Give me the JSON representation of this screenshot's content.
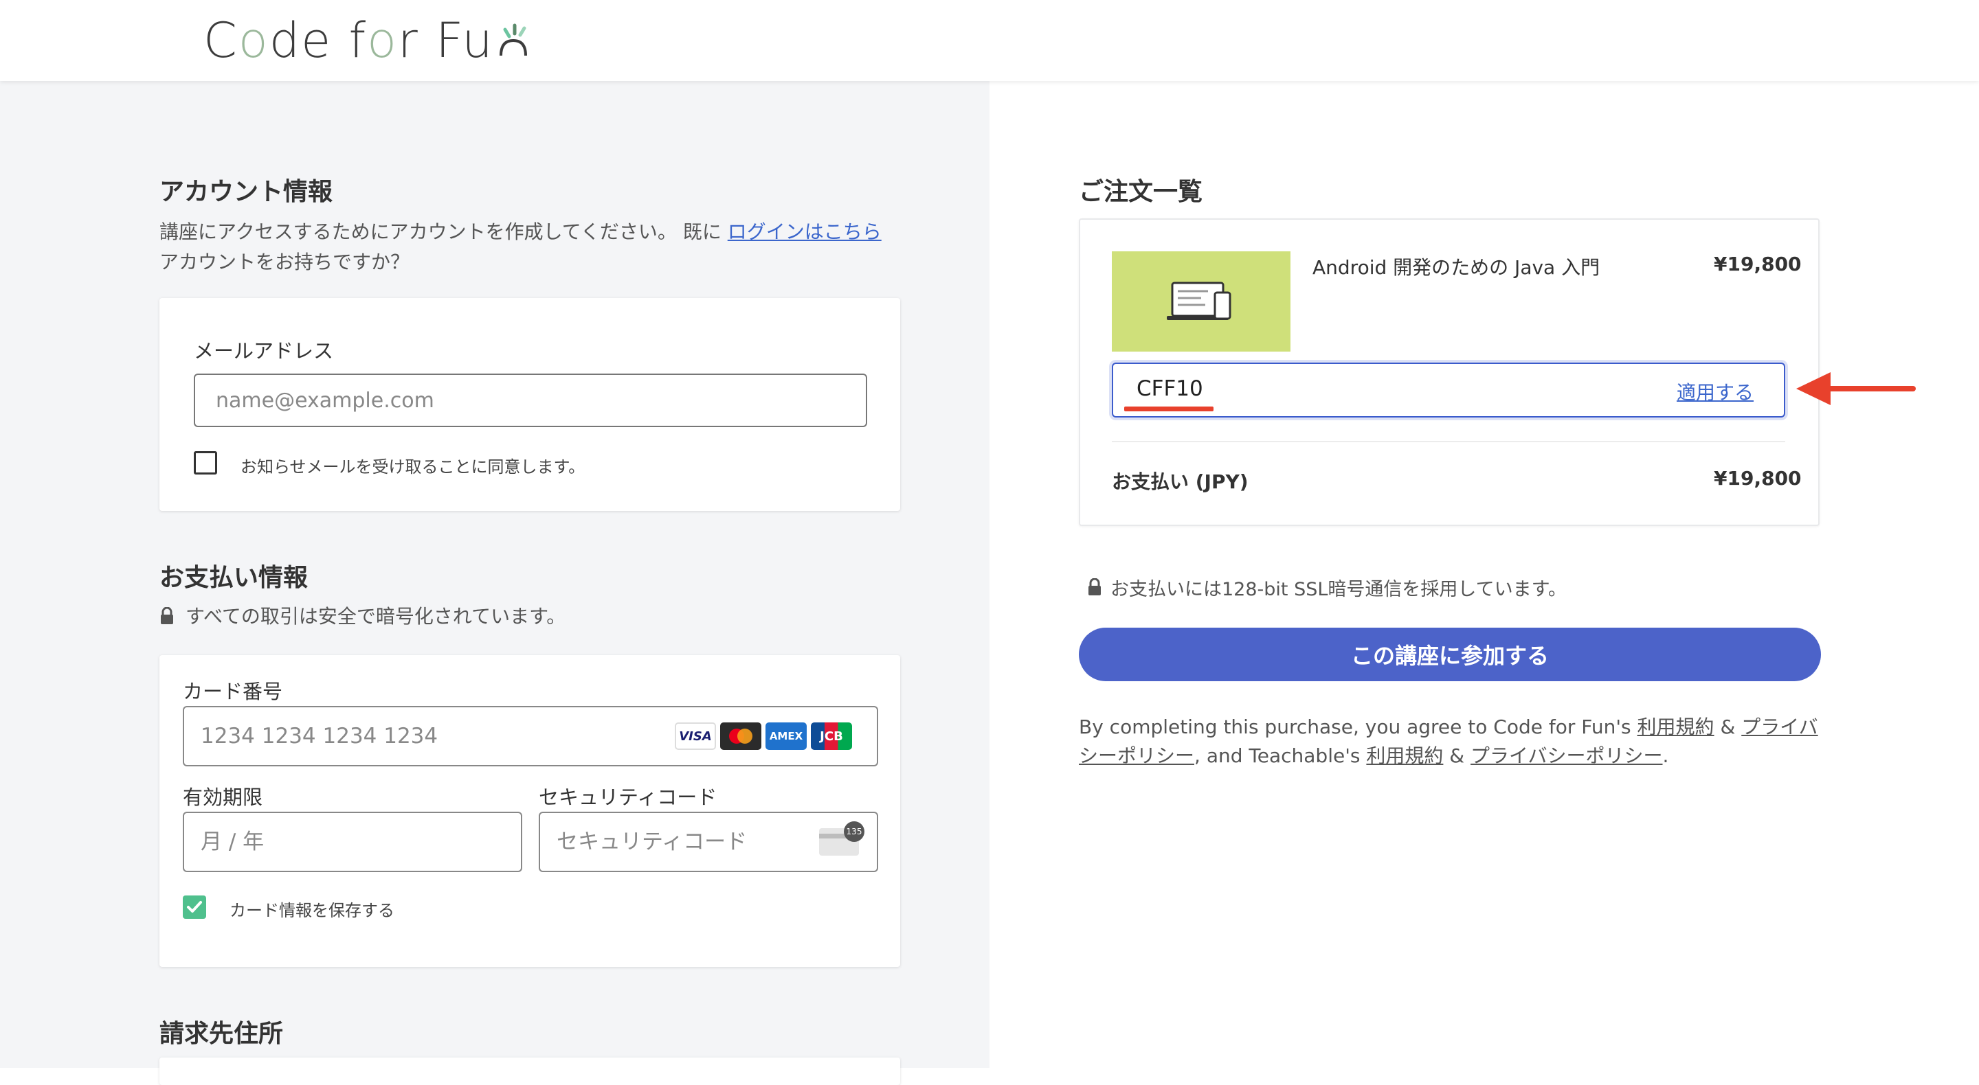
{
  "header": {
    "logo_text_1": "C",
    "logo_text_o": "o",
    "logo_text_2": "de f",
    "logo_text_o2": "o",
    "logo_text_3": "r Fu",
    "logo_icon": "sparkle-n-logo-mark"
  },
  "account": {
    "title": "アカウント情報",
    "desc_prefix": "講座にアクセスするためにアカウントを作成してください。 既に",
    "login_link": "ログインはこちら",
    "desc_suffix": "アカウントをお持ちですか？",
    "email_label": "メールアドレス",
    "email_placeholder": "name@example.com",
    "newsletter_label": "お知らせメールを受け取ることに同意します。"
  },
  "payment": {
    "title": "お支払い情報",
    "secure_note": "すべての取引は安全で暗号化されています。",
    "card_number_label": "カード番号",
    "card_number_placeholder": "1234 1234 1234 1234",
    "expiry_label": "有効期限",
    "expiry_placeholder": "月 / 年",
    "cvc_label": "セキュリティコード",
    "cvc_placeholder": "セキュリティコード",
    "cvc_badge": "135",
    "save_card_label": "カード情報を保存する",
    "brands": [
      "VISA",
      "mastercard",
      "AMEX",
      "JCB"
    ]
  },
  "billing": {
    "title": "請求先住所"
  },
  "order": {
    "title": "ご注文一覧",
    "product_name": "Android 開発のための Java 入門",
    "product_price": "¥19,800",
    "coupon_value": "CFF10",
    "apply_label": "適用する",
    "total_label": "お支払い (JPY)",
    "total_value": "¥19,800"
  },
  "ssl_note": "お支払いには128-bit SSL暗号通信を採用しています。",
  "pay_button": "この講座に参加する",
  "terms": {
    "t1": "By completing this purchase, you agree to Code for Fun's ",
    "l1": "利用規約",
    "t2": " & ",
    "l2": "プライバシーポリシー",
    "t3": ", and Teachable's ",
    "l3": "利用規約",
    "t4": " & ",
    "l4": "プライバシーポリシー",
    "t5": "."
  },
  "colors": {
    "accent": "#4c63c9",
    "link": "#3b66cc",
    "annotation_red": "#e8412c",
    "check_green": "#4fc08d",
    "thumbnail": "#cfe07a"
  }
}
